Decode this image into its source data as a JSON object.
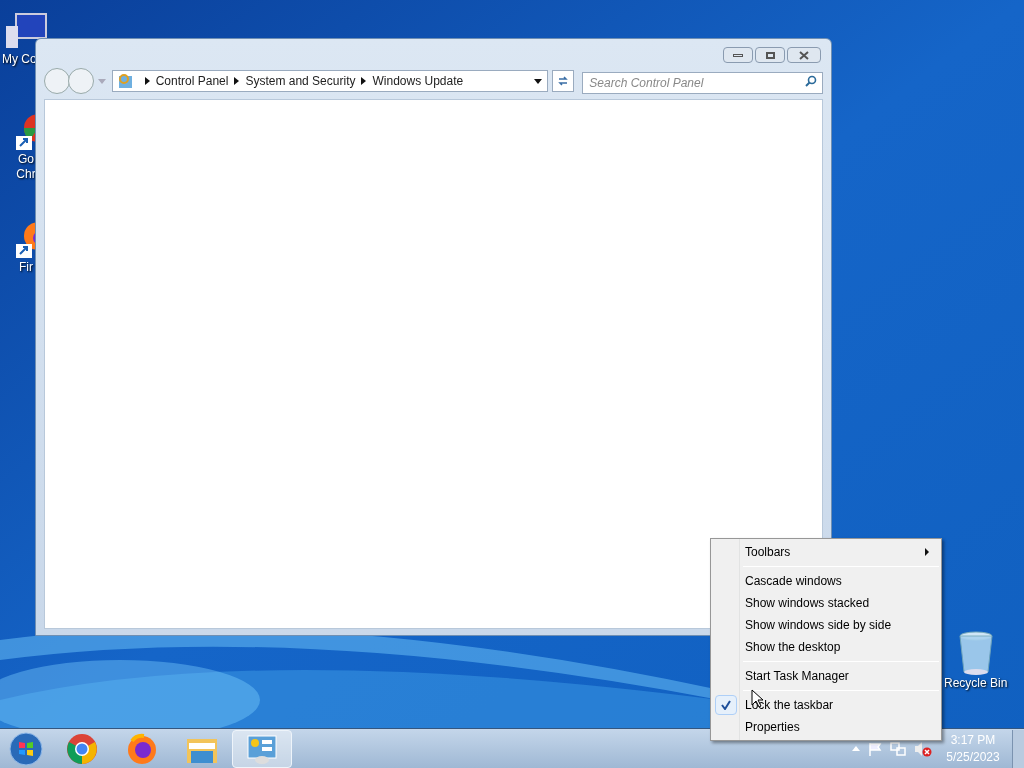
{
  "desktop_icons": [
    {
      "kind": "computer",
      "lines": [
        "My Co"
      ]
    },
    {
      "kind": "chrome",
      "lines": [
        "Go",
        "Chr"
      ]
    },
    {
      "kind": "firefox",
      "lines": [
        "Fir"
      ]
    },
    {
      "kind": "recycle",
      "lines": [
        "Recycle Bin"
      ]
    }
  ],
  "window": {
    "breadcrumb": [
      "Control Panel",
      "System and Security",
      "Windows Update"
    ],
    "search": {
      "placeholder": "Search Control Panel"
    }
  },
  "context_menu": [
    {
      "kind": "item",
      "label": "Toolbars",
      "submenu": true,
      "checked": false
    },
    {
      "kind": "separator"
    },
    {
      "kind": "item",
      "label": "Cascade windows",
      "submenu": false,
      "checked": false
    },
    {
      "kind": "item",
      "label": "Show windows stacked",
      "submenu": false,
      "checked": false
    },
    {
      "kind": "item",
      "label": "Show windows side by side",
      "submenu": false,
      "checked": false
    },
    {
      "kind": "item",
      "label": "Show the desktop",
      "submenu": false,
      "checked": false
    },
    {
      "kind": "separator"
    },
    {
      "kind": "item",
      "label": "Start Task Manager",
      "submenu": false,
      "checked": false
    },
    {
      "kind": "separator"
    },
    {
      "kind": "item",
      "label": "Lock the taskbar",
      "submenu": false,
      "checked": true
    },
    {
      "kind": "item",
      "label": "Properties",
      "submenu": false,
      "checked": false
    }
  ],
  "taskbar": {
    "buttons": [
      {
        "kind": "start",
        "selected": false
      },
      {
        "kind": "chrome",
        "selected": false
      },
      {
        "kind": "firefox",
        "selected": false
      },
      {
        "kind": "explorer",
        "selected": false
      },
      {
        "kind": "control-panel",
        "selected": true
      }
    ],
    "clock": {
      "time": "3:17 PM",
      "date": "5/25/2023"
    }
  }
}
